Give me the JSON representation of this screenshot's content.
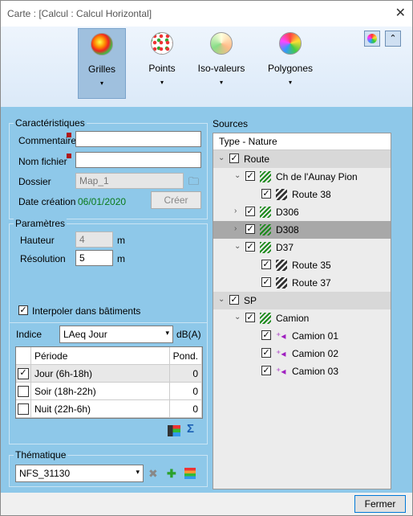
{
  "window": {
    "title": "Carte :  [Calcul : Calcul Horizontal]",
    "close_glyph": "✕"
  },
  "ribbon": {
    "items": [
      {
        "label": "Grilles",
        "icon": "grid-map-icon"
      },
      {
        "label": "Points",
        "icon": "points-map-icon"
      },
      {
        "label": "Iso-valeurs",
        "icon": "iso-values-icon"
      },
      {
        "label": "Polygones",
        "icon": "polygons-icon"
      }
    ],
    "arrow": "▾"
  },
  "caracteristiques": {
    "title": "Caractéristiques",
    "commentaire_label": "Commentaire",
    "commentaire_value": "",
    "nom_fichier_label": "Nom fichier",
    "nom_fichier_value": "",
    "dossier_label": "Dossier",
    "dossier_value": "Map_1",
    "date_label": "Date création",
    "date_value": "06/01/2020",
    "creer_label": "Créer"
  },
  "parametres": {
    "title": "Paramètres",
    "hauteur_label": "Hauteur",
    "hauteur_value": "4",
    "hauteur_unit": "m",
    "resolution_label": "Résolution",
    "resolution_value": "5",
    "resolution_unit": "m",
    "interpoler_label": "Interpoler dans bâtiments",
    "interpoler_checked": true
  },
  "indice": {
    "label": "Indice",
    "value": "LAeq Jour",
    "unit": "dB(A)",
    "columns": [
      "Période",
      "Pond."
    ],
    "rows": [
      {
        "checked": true,
        "periode": "Jour (6h-18h)",
        "pond": "0"
      },
      {
        "checked": false,
        "periode": "Soir (18h-22h)",
        "pond": "0"
      },
      {
        "checked": false,
        "periode": "Nuit (22h-6h)",
        "pond": "0"
      }
    ]
  },
  "thematique": {
    "title": "Thématique",
    "value": "NFS_31130"
  },
  "sources": {
    "title": "Sources",
    "header": "Type - Nature",
    "rows": [
      {
        "label": "Route",
        "depth": 0,
        "expander": "⌄",
        "icon": "",
        "group": true,
        "selected": false
      },
      {
        "label": "Ch de l'Aunay Pion",
        "depth": 1,
        "expander": "⌄",
        "icon": "hatch",
        "group": false,
        "selected": false
      },
      {
        "label": "Route 38",
        "depth": 2,
        "expander": "",
        "icon": "road",
        "group": false,
        "selected": false
      },
      {
        "label": "D306",
        "depth": 1,
        "expander": "›",
        "icon": "hatch",
        "group": false,
        "selected": false
      },
      {
        "label": "D308",
        "depth": 1,
        "expander": "›",
        "icon": "hatch",
        "group": false,
        "selected": true
      },
      {
        "label": "D37",
        "depth": 1,
        "expander": "⌄",
        "icon": "hatch",
        "group": false,
        "selected": false
      },
      {
        "label": "Route 35",
        "depth": 2,
        "expander": "",
        "icon": "road",
        "group": false,
        "selected": false
      },
      {
        "label": "Route 37",
        "depth": 2,
        "expander": "",
        "icon": "road",
        "group": false,
        "selected": false
      },
      {
        "label": "SP",
        "depth": 0,
        "expander": "⌄",
        "icon": "",
        "group": true,
        "selected": false
      },
      {
        "label": "Camion",
        "depth": 1,
        "expander": "⌄",
        "icon": "hatch",
        "group": false,
        "selected": false
      },
      {
        "label": "Camion 01",
        "depth": 2,
        "expander": "",
        "icon": "src",
        "group": false,
        "selected": false
      },
      {
        "label": "Camion 02",
        "depth": 2,
        "expander": "",
        "icon": "src",
        "group": false,
        "selected": false
      },
      {
        "label": "Camion 03",
        "depth": 2,
        "expander": "",
        "icon": "src",
        "group": false,
        "selected": false
      }
    ]
  },
  "footer": {
    "close_label": "Fermer"
  },
  "glyphs": {
    "check": "✓",
    "dropdown": "▾",
    "delete": "✖",
    "add": "✚",
    "folder": "🗀",
    "sigma": "Σ",
    "chevrons": "⌃"
  }
}
